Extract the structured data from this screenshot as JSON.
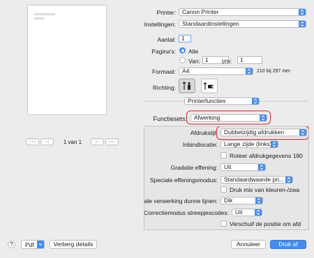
{
  "preview": {
    "thumb_lines": [
      "oooooooooo",
      "ooooo"
    ],
    "pager": "1 van 1",
    "nav_first": "◁◁",
    "nav_prev": "◁",
    "nav_next": "▷",
    "nav_last": "▷▷"
  },
  "form": {
    "printer_label": "Printer:",
    "printer_value": "Canon Printer",
    "instellingen_label": "Instellingen:",
    "instellingen_value": "Standaardinstellingen",
    "aantal_label": "Aantal:",
    "aantal_value": "1",
    "paginas_label": "Pagina's:",
    "alle_label": "Alle",
    "van_label": "Van:",
    "van_value": "1",
    "tm_label": "t/m:",
    "tm_value": "1",
    "formaat_label": "Formaat:",
    "formaat_value": "A4",
    "formaat_dims": "210 bij 297 mm",
    "richting_label": "Richting:",
    "section_value": "Printerfuncties",
    "functiesets_label": "Functiesets:",
    "functiesets_value": "Afwerking"
  },
  "panel": {
    "afdrukstijl_label": "Afdrukstijl:",
    "afdrukstijl_value": "Dubbelzijdig afdrukken",
    "inbindlocatie_label": "Inbindlocatie:",
    "inbindlocatie_value": "Lange zijde (links)",
    "roteer_label": "Roteer afdrukgegevens 180",
    "gradatie_label": "Gradatie effening:",
    "gradatie_value": "Uit",
    "speciale_label": "Speciale effeningsmodus:",
    "speciale_value": "Standaardwaarde pri...",
    "drukmix_label": "Druk mix van kleuren-/zwa",
    "dunne_label": "Speciale verwerking dunne lijnen:",
    "dunne_value": "Dik",
    "correctie_label": "Correctiemodus streepjescodes:",
    "correctie_value": "Uit",
    "verschuif_label": "Verschuif de positie om afd"
  },
  "footer": {
    "help": "?",
    "pdf": "Pdf",
    "details": "Verberg details",
    "annuleer": "Annuleer",
    "drukaf": "Druk af"
  },
  "colors": {
    "accent": "#3f8df5",
    "highlight": "#d9262b"
  }
}
